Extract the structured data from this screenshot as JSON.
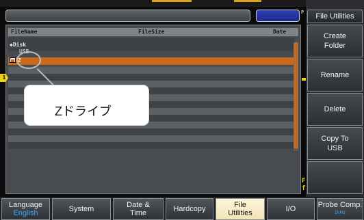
{
  "file_browser": {
    "columns": {
      "name": "FileName",
      "size": "FileSize",
      "date": "Date"
    },
    "items": [
      {
        "label": "Disk",
        "icon": "disk-icon"
      },
      {
        "label": "USB",
        "icon": "usb-icon"
      },
      {
        "label": "Z",
        "icon": "folder-icon",
        "selected": true
      }
    ]
  },
  "callout": {
    "text": "Zドライブ"
  },
  "side_menu": {
    "title": "File Utilities",
    "buttons": [
      "Create\nFolder",
      "Rename",
      "Delete",
      "Copy To\nUSB",
      ""
    ]
  },
  "bottom_menu": {
    "language": {
      "label": "Language",
      "value": "English"
    },
    "system": "System",
    "date_time": {
      "line1": "Date &",
      "line2": "Time"
    },
    "hardcopy": "Hardcopy",
    "file_utilities": {
      "line1": "File",
      "line2": "Utilities"
    },
    "io": "I/O",
    "probe_comp": {
      "label": "Probe Comp.",
      "value": "1kHz"
    }
  },
  "indicators": {
    "channel": "1",
    "right_edge": "P",
    "right_f": "F\nf"
  },
  "colors": {
    "accent": "#c86a1a",
    "selection_active": "#f2e4b8",
    "channel_marker": "#f0d010"
  }
}
